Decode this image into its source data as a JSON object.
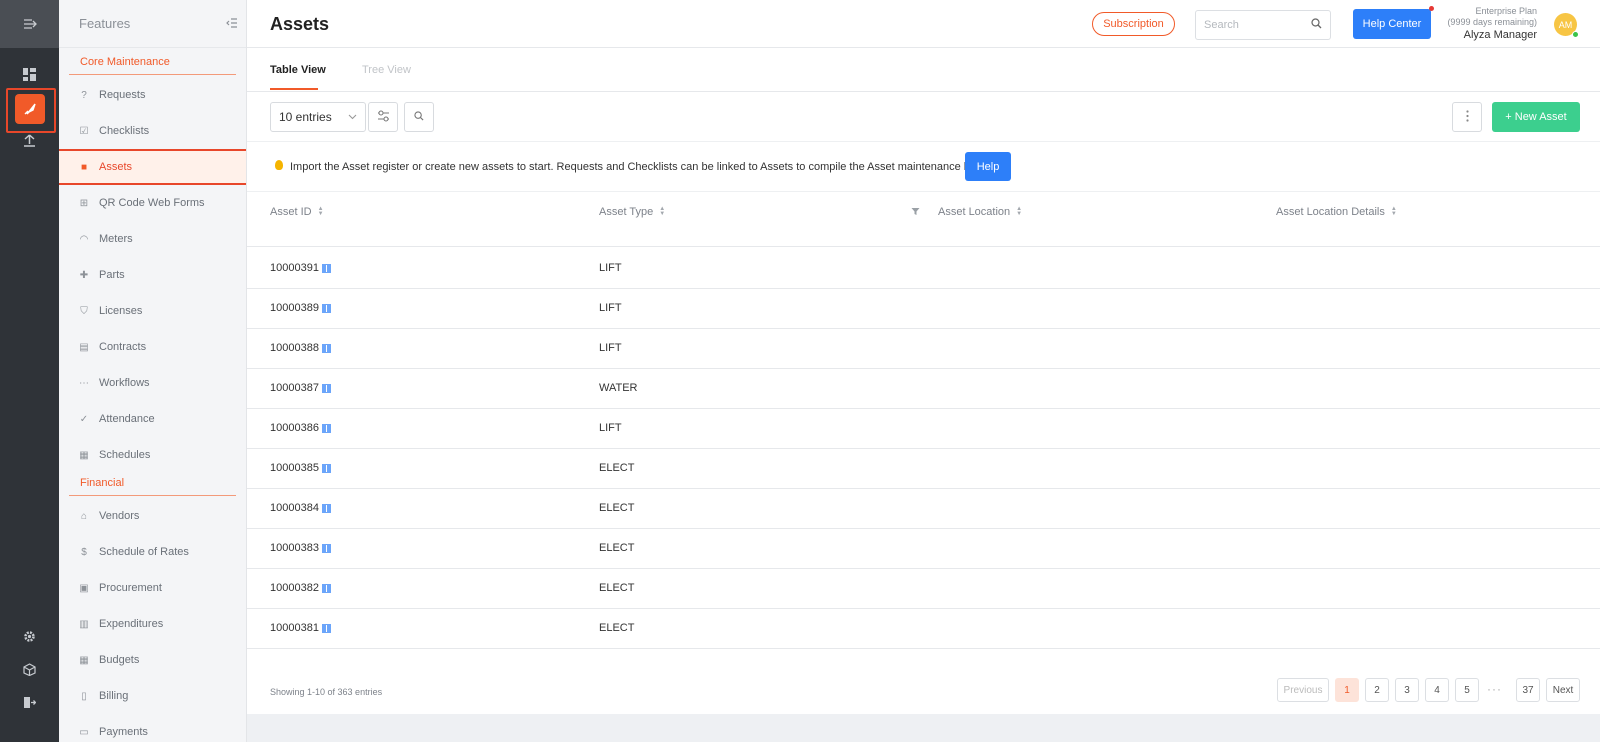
{
  "rail": {
    "icons": [
      "collapse-icon",
      "dashboard-icon",
      "rocket-icon",
      "upload-icon",
      "settings-icon",
      "box-icon",
      "logout-icon"
    ]
  },
  "sidebar": {
    "title": "Features",
    "sections": [
      {
        "label": "Core Maintenance",
        "items": [
          {
            "label": "Requests",
            "icon": "request-icon",
            "glyph": "?"
          },
          {
            "label": "Checklists",
            "icon": "checklist-icon",
            "glyph": "☑"
          },
          {
            "label": "Assets",
            "icon": "asset-icon",
            "glyph": "■",
            "active": true
          },
          {
            "label": "QR Code Web Forms",
            "icon": "qr-icon",
            "glyph": "⊞"
          },
          {
            "label": "Meters",
            "icon": "meter-icon",
            "glyph": "◠"
          },
          {
            "label": "Parts",
            "icon": "parts-icon",
            "glyph": "✚"
          },
          {
            "label": "Licenses",
            "icon": "license-icon",
            "glyph": "⛉"
          },
          {
            "label": "Contracts",
            "icon": "contract-icon",
            "glyph": "▤"
          },
          {
            "label": "Workflows",
            "icon": "workflow-icon",
            "glyph": "⋯"
          },
          {
            "label": "Attendance",
            "icon": "attendance-icon",
            "glyph": "✓"
          },
          {
            "label": "Schedules",
            "icon": "schedule-icon",
            "glyph": "▦"
          }
        ]
      },
      {
        "label": "Financial",
        "items": [
          {
            "label": "Vendors",
            "icon": "vendor-icon",
            "glyph": "⌂"
          },
          {
            "label": "Schedule of Rates",
            "icon": "dollar-icon",
            "glyph": "$"
          },
          {
            "label": "Procurement",
            "icon": "procurement-icon",
            "glyph": "▣"
          },
          {
            "label": "Expenditures",
            "icon": "expenditure-icon",
            "glyph": "▥"
          },
          {
            "label": "Budgets",
            "icon": "budget-icon",
            "glyph": "▦"
          },
          {
            "label": "Billing",
            "icon": "billing-icon",
            "glyph": "▯"
          },
          {
            "label": "Payments",
            "icon": "payment-icon",
            "glyph": "▭"
          }
        ]
      }
    ]
  },
  "header": {
    "title": "Assets",
    "subscription_label": "Subscription",
    "search_placeholder": "Search",
    "help_center_label": "Help Center",
    "plan_name": "Enterprise Plan",
    "plan_remaining": "(9999 days remaining)",
    "user_name": "Alyza Manager",
    "avatar_initials": "AM"
  },
  "tabs": [
    {
      "label": "Table View",
      "active": true
    },
    {
      "label": "Tree View",
      "active": false
    }
  ],
  "toolbar": {
    "entries_value": "10 entries",
    "new_asset_label": "+ New Asset"
  },
  "banner": {
    "text": "Import the Asset register or create new assets to start. Requests and Checklists can be linked to Assets to compile the Asset maintenance history.",
    "help_label": "Help"
  },
  "table": {
    "columns": [
      "Asset ID",
      "Asset Type",
      "Asset Location",
      "Asset Location Details"
    ],
    "rows": [
      {
        "id": "10000391",
        "type": "LIFT",
        "location": "",
        "details": ""
      },
      {
        "id": "10000389",
        "type": "LIFT",
        "location": "",
        "details": ""
      },
      {
        "id": "10000388",
        "type": "LIFT",
        "location": "",
        "details": ""
      },
      {
        "id": "10000387",
        "type": "WATER",
        "location": "",
        "details": ""
      },
      {
        "id": "10000386",
        "type": "LIFT",
        "location": "",
        "details": ""
      },
      {
        "id": "10000385",
        "type": "ELECT",
        "location": "",
        "details": ""
      },
      {
        "id": "10000384",
        "type": "ELECT",
        "location": "",
        "details": ""
      },
      {
        "id": "10000383",
        "type": "ELECT",
        "location": "",
        "details": ""
      },
      {
        "id": "10000382",
        "type": "ELECT",
        "location": "",
        "details": ""
      },
      {
        "id": "10000381",
        "type": "ELECT",
        "location": "",
        "details": ""
      }
    ]
  },
  "pagination": {
    "showing": "Showing 1-10 of 363 entries",
    "previous": "Previous",
    "pages": [
      "1",
      "2",
      "3",
      "4",
      "5"
    ],
    "current": "1",
    "ellipsis": "···",
    "last": "37",
    "next": "Next"
  },
  "colors": {
    "accent": "#f15a29",
    "primary": "#2d7ff9",
    "success": "#3ccf8e"
  }
}
